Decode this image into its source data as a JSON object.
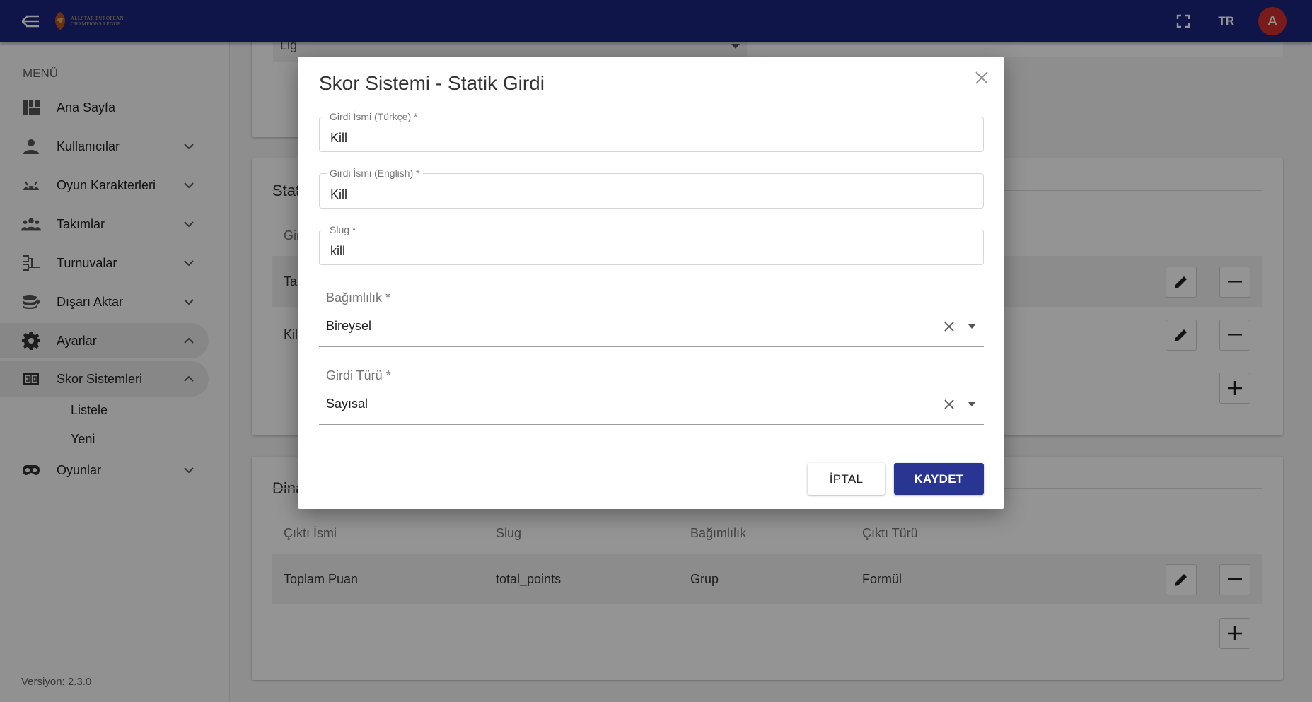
{
  "header": {
    "logo_text_line1": "ALLSTAR EUROPEAN",
    "logo_text_line2": "CHAMPIONS LEGUE",
    "language": "TR",
    "avatar_initial": "A",
    "brand_color": "#1a237e",
    "avatar_color": "#d32f2f"
  },
  "sidebar": {
    "menu_title": "MENÜ",
    "items": [
      {
        "label": "Ana Sayfa",
        "icon": "dashboard-icon"
      },
      {
        "label": "Kullanıcılar",
        "icon": "person-icon"
      },
      {
        "label": "Oyun Karakterleri",
        "icon": "android-icon"
      },
      {
        "label": "Takımlar",
        "icon": "group-icon"
      },
      {
        "label": "Turnuvalar",
        "icon": "bracket-icon"
      },
      {
        "label": "Dışarı Aktar",
        "icon": "export-icon"
      },
      {
        "label": "Ayarlar",
        "icon": "gear-icon"
      },
      {
        "label": "Skor Sistemleri",
        "icon": "scoreboard-icon"
      },
      {
        "label": "Oyunlar",
        "icon": "gamepad-icon"
      }
    ],
    "sub_items": [
      "Listele",
      "Yeni"
    ],
    "version": "Versiyon: 2.3.0"
  },
  "background": {
    "top_select_value": "Lig",
    "static_card_title": "Stat",
    "static_header_first": "Gir",
    "static_rows": [
      "Tak",
      "Kil"
    ],
    "dynamic_card_title": "Dina",
    "dynamic_headers": [
      "Çıktı İsmi",
      "Slug",
      "Bağımlılık",
      "Çıktı Türü"
    ],
    "dynamic_rows": [
      {
        "name": "Toplam Puan",
        "slug": "total_points",
        "dependency": "Grup",
        "type": "Formül"
      }
    ]
  },
  "dialog": {
    "title": "Skor Sistemi - Statik Girdi",
    "fields": {
      "name_tr": {
        "label": "Girdi İsmi (Türkçe) *",
        "value": "Kill"
      },
      "name_en": {
        "label": "Girdi İsmi (English) *",
        "value": "Kill"
      },
      "slug": {
        "label": "Slug *",
        "value": "kill"
      },
      "dependency": {
        "label": "Bağımlılık *",
        "value": "Bireysel"
      },
      "input_type": {
        "label": "Girdi Türü *",
        "value": "Sayısal"
      }
    },
    "cancel_label": "İPTAL",
    "save_label": "KAYDET",
    "save_color": "#283593"
  }
}
